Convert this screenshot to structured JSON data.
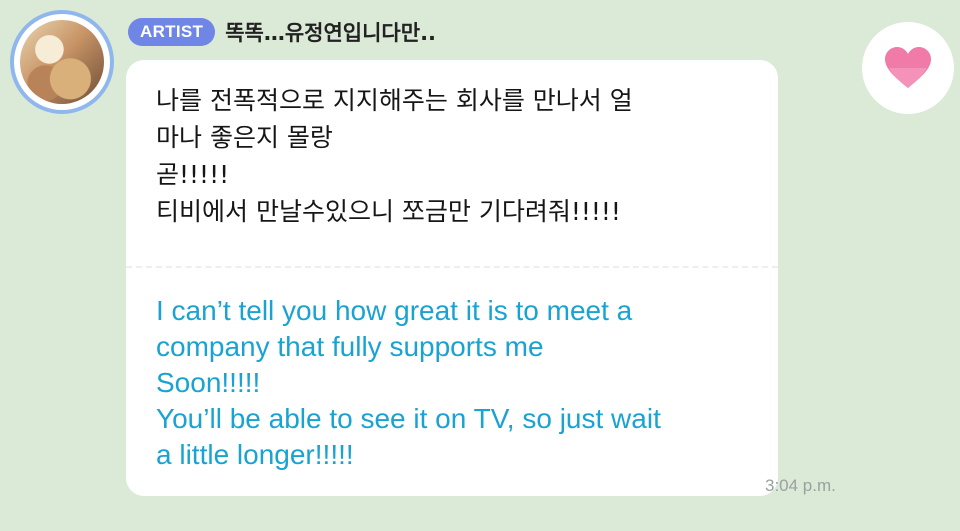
{
  "post": {
    "badge": "ARTIST",
    "author": "똑똑…유정연입니다만..",
    "original_lines": [
      "나를 전폭적으로 지지해주는 회사를 만나서 얼",
      "마나 좋은지 몰랑",
      "곧!!!!!",
      "티비에서 만날수있으니 쪼금만 기다려줘!!!!!"
    ],
    "translation_lines": [
      "I can’t tell you how great it is to meet a",
      "company that fully supports me",
      "Soon!!!!!",
      "You’ll be able to see it on TV, so just wait",
      "a little longer!!!!!"
    ],
    "time": "3:04 p.m."
  },
  "icons": {
    "like": "heart-icon",
    "avatar": "profile-photo"
  },
  "colors": {
    "background": "#dbe9d7",
    "badge": "#6f86e6",
    "translation": "#1aa3d2",
    "heart": "#f07aa8",
    "avatar_ring": "#8fb7ee"
  }
}
